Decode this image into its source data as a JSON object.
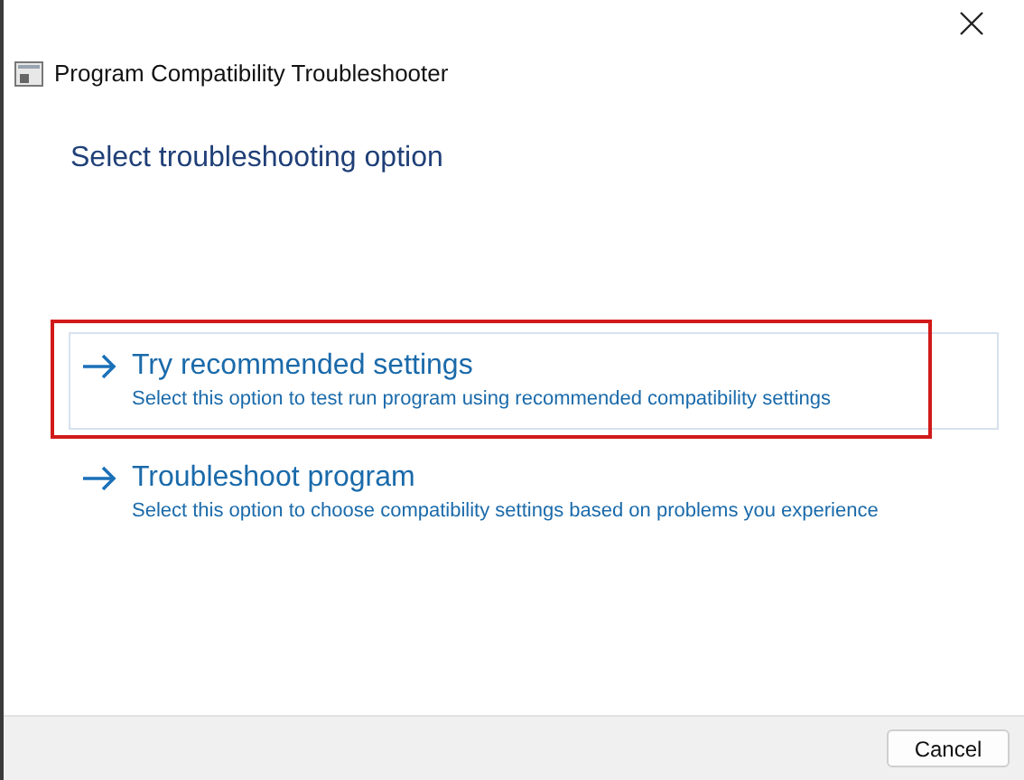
{
  "window": {
    "title": "Program Compatibility Troubleshooter"
  },
  "heading": "Select troubleshooting option",
  "options": [
    {
      "title": "Try recommended settings",
      "description": "Select this option to test run program using recommended compatibility settings",
      "selected": true,
      "annotated": true
    },
    {
      "title": "Troubleshoot program",
      "description": "Select this option to choose compatibility settings based on problems you experience",
      "selected": false,
      "annotated": false
    }
  ],
  "buttons": [
    "Cancel"
  ]
}
